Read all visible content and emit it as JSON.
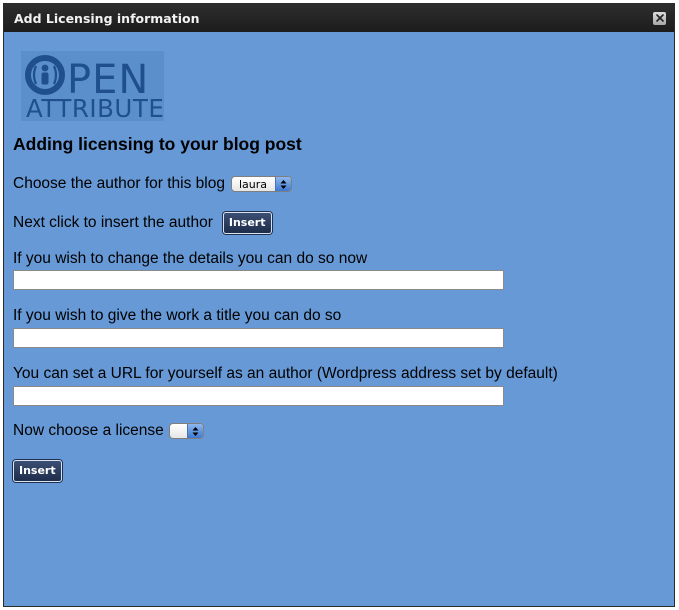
{
  "window": {
    "title": "Add Licensing information",
    "close_icon": "close-icon"
  },
  "logo": {
    "line1": "OPEN",
    "line2": "ATTRIBUTE",
    "color": "#1f4f8c"
  },
  "heading": "Adding licensing to your blog post",
  "author": {
    "label": "Choose the author for this blog",
    "selected": "laura"
  },
  "insert_author": {
    "label": "Next click to insert the author",
    "button": "Insert"
  },
  "details": {
    "label": "If you wish to change the details you can do so now",
    "value": ""
  },
  "work_title": {
    "label": "If you wish to give the work a title you can do so",
    "value": ""
  },
  "author_url": {
    "label": "You can set a URL for yourself as an author (Wordpress address set by default)",
    "value": ""
  },
  "license": {
    "label": "Now choose a license",
    "selected": ""
  },
  "final_insert": {
    "button": "Insert"
  },
  "colors": {
    "panel_bg": "#6699d6",
    "titlebar_bg": "#1c1c1c",
    "button_bg": "#1e2d4a"
  }
}
